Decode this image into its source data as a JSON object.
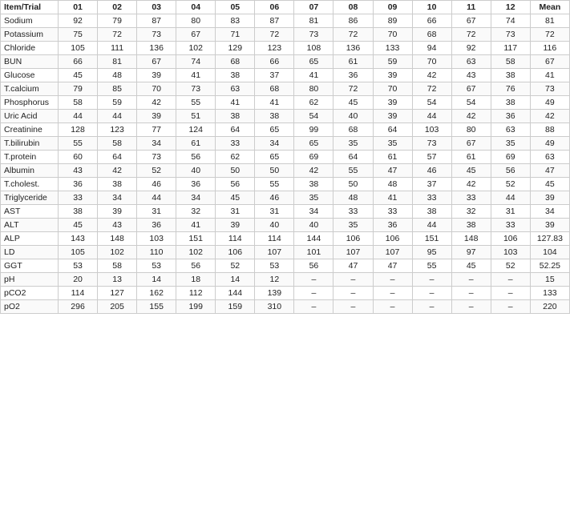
{
  "table": {
    "headers": [
      "Item/Trial",
      "01",
      "02",
      "03",
      "04",
      "05",
      "06",
      "07",
      "08",
      "09",
      "10",
      "11",
      "12",
      "Mean"
    ],
    "rows": [
      [
        "Sodium",
        "92",
        "79",
        "87",
        "80",
        "83",
        "87",
        "81",
        "86",
        "89",
        "66",
        "67",
        "74",
        "81"
      ],
      [
        "Potassium",
        "75",
        "72",
        "73",
        "67",
        "71",
        "72",
        "73",
        "72",
        "70",
        "68",
        "72",
        "73",
        "72"
      ],
      [
        "Chloride",
        "105",
        "111",
        "136",
        "102",
        "129",
        "123",
        "108",
        "136",
        "133",
        "94",
        "92",
        "117",
        "116"
      ],
      [
        "BUN",
        "66",
        "81",
        "67",
        "74",
        "68",
        "66",
        "65",
        "61",
        "59",
        "70",
        "63",
        "58",
        "67"
      ],
      [
        "Glucose",
        "45",
        "48",
        "39",
        "41",
        "38",
        "37",
        "41",
        "36",
        "39",
        "42",
        "43",
        "38",
        "41"
      ],
      [
        "T.calcium",
        "79",
        "85",
        "70",
        "73",
        "63",
        "68",
        "80",
        "72",
        "70",
        "72",
        "67",
        "76",
        "73"
      ],
      [
        "Phosphorus",
        "58",
        "59",
        "42",
        "55",
        "41",
        "41",
        "62",
        "45",
        "39",
        "54",
        "54",
        "38",
        "49"
      ],
      [
        "Uric Acid",
        "44",
        "44",
        "39",
        "51",
        "38",
        "38",
        "54",
        "40",
        "39",
        "44",
        "42",
        "36",
        "42"
      ],
      [
        "Creatinine",
        "128",
        "123",
        "77",
        "124",
        "64",
        "65",
        "99",
        "68",
        "64",
        "103",
        "80",
        "63",
        "88"
      ],
      [
        "T.bilirubin",
        "55",
        "58",
        "34",
        "61",
        "33",
        "34",
        "65",
        "35",
        "35",
        "73",
        "67",
        "35",
        "49"
      ],
      [
        "T.protein",
        "60",
        "64",
        "73",
        "56",
        "62",
        "65",
        "69",
        "64",
        "61",
        "57",
        "61",
        "69",
        "63"
      ],
      [
        "Albumin",
        "43",
        "42",
        "52",
        "40",
        "50",
        "50",
        "42",
        "55",
        "47",
        "46",
        "45",
        "56",
        "47"
      ],
      [
        "T.cholest.",
        "36",
        "38",
        "46",
        "36",
        "56",
        "55",
        "38",
        "50",
        "48",
        "37",
        "42",
        "52",
        "45"
      ],
      [
        "Triglyceride",
        "33",
        "34",
        "44",
        "34",
        "45",
        "46",
        "35",
        "48",
        "41",
        "33",
        "33",
        "44",
        "39"
      ],
      [
        "AST",
        "38",
        "39",
        "31",
        "32",
        "31",
        "31",
        "34",
        "33",
        "33",
        "38",
        "32",
        "31",
        "34"
      ],
      [
        "ALT",
        "45",
        "43",
        "36",
        "41",
        "39",
        "40",
        "40",
        "35",
        "36",
        "44",
        "38",
        "33",
        "39"
      ],
      [
        "ALP",
        "143",
        "148",
        "103",
        "151",
        "114",
        "114",
        "144",
        "106",
        "106",
        "151",
        "148",
        "106",
        "127.83"
      ],
      [
        "LD",
        "105",
        "102",
        "110",
        "102",
        "106",
        "107",
        "101",
        "107",
        "107",
        "95",
        "97",
        "103",
        "104"
      ],
      [
        "GGT",
        "53",
        "58",
        "53",
        "56",
        "52",
        "53",
        "56",
        "47",
        "47",
        "55",
        "45",
        "52",
        "52.25"
      ],
      [
        "pH",
        "20",
        "13",
        "14",
        "18",
        "14",
        "12",
        "–",
        "–",
        "–",
        "–",
        "–",
        "–",
        "15"
      ],
      [
        "pCO2",
        "114",
        "127",
        "162",
        "112",
        "144",
        "139",
        "–",
        "–",
        "–",
        "–",
        "–",
        "–",
        "133"
      ],
      [
        "pO2",
        "296",
        "205",
        "155",
        "199",
        "159",
        "310",
        "–",
        "–",
        "–",
        "–",
        "–",
        "–",
        "220"
      ]
    ]
  }
}
